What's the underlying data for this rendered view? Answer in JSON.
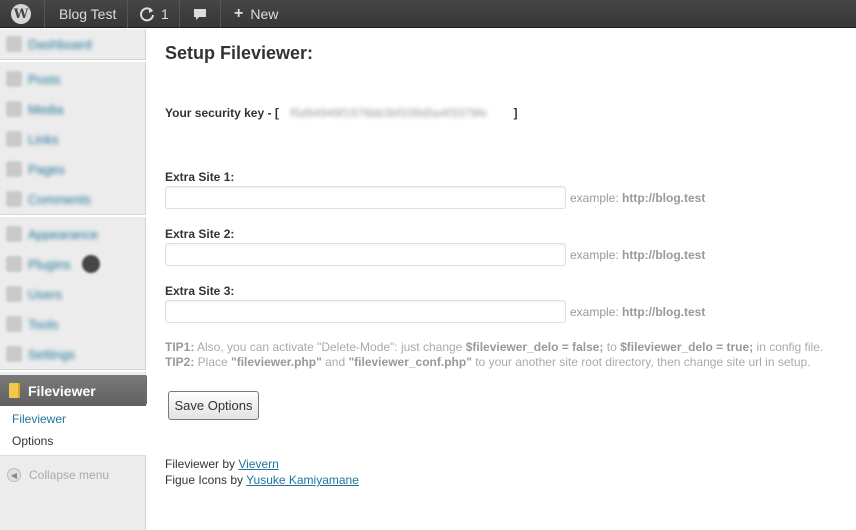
{
  "adminbar": {
    "site_name": "Blog Test",
    "updates_count": "1",
    "new_label": "New",
    "wp_logo": "W"
  },
  "sidebar": {
    "items": [
      {
        "label": "Dashboard",
        "icon": "dashboard-icon"
      },
      {
        "label": "Posts",
        "icon": "posts-icon"
      },
      {
        "label": "Media",
        "icon": "media-icon"
      },
      {
        "label": "Links",
        "icon": "links-icon"
      },
      {
        "label": "Pages",
        "icon": "pages-icon"
      },
      {
        "label": "Comments",
        "icon": "comments-icon"
      },
      {
        "label": "Appearance",
        "icon": "appearance-icon"
      },
      {
        "label": "Plugins",
        "icon": "plugins-icon"
      },
      {
        "label": "Users",
        "icon": "users-icon"
      },
      {
        "label": "Tools",
        "icon": "tools-icon"
      },
      {
        "label": "Settings",
        "icon": "settings-icon"
      }
    ],
    "current": {
      "label": "Fileviewer",
      "icon": "fileviewer-icon"
    },
    "submenu": [
      {
        "label": "Fileviewer"
      },
      {
        "label": "Options"
      }
    ],
    "collapse_label": "Collapse menu"
  },
  "main": {
    "title": "Setup Fileviewer:",
    "security_key_label": "Your security key - [",
    "security_key_value": "f5d64949f1976bb3bf339d5a4f3379fe",
    "security_key_close": "]",
    "sites": [
      {
        "label": "Extra Site 1:",
        "value": "",
        "example_prefix": "example: ",
        "example_url": "http://blog.test"
      },
      {
        "label": "Extra Site 2:",
        "value": "",
        "example_prefix": "example: ",
        "example_url": "http://blog.test"
      },
      {
        "label": "Extra Site 3:",
        "value": "",
        "example_prefix": "example: ",
        "example_url": "http://blog.test"
      }
    ],
    "tip1": {
      "head": "TIP1:",
      "t1": " Also, you can activate \"Delete-Mode\": just change ",
      "b1": "$fileviewer_delo = false;",
      "t2": " to ",
      "b2": "$fileviewer_delo = true;",
      "t3": " in config file."
    },
    "tip2": {
      "head": "TIP2:",
      "t1": " Place ",
      "b1": "\"fileviewer.php\"",
      "t2": " and ",
      "b2": "\"fileviewer_conf.php\"",
      "t3": " to your another site root directory, then change site url in setup."
    },
    "save_label": "Save Options",
    "credit1": {
      "prefix": "Fileviewer by ",
      "link": "Vievern"
    },
    "credit2": {
      "prefix": "Figue Icons by ",
      "link": "Yusuke Kamiyamane"
    }
  }
}
